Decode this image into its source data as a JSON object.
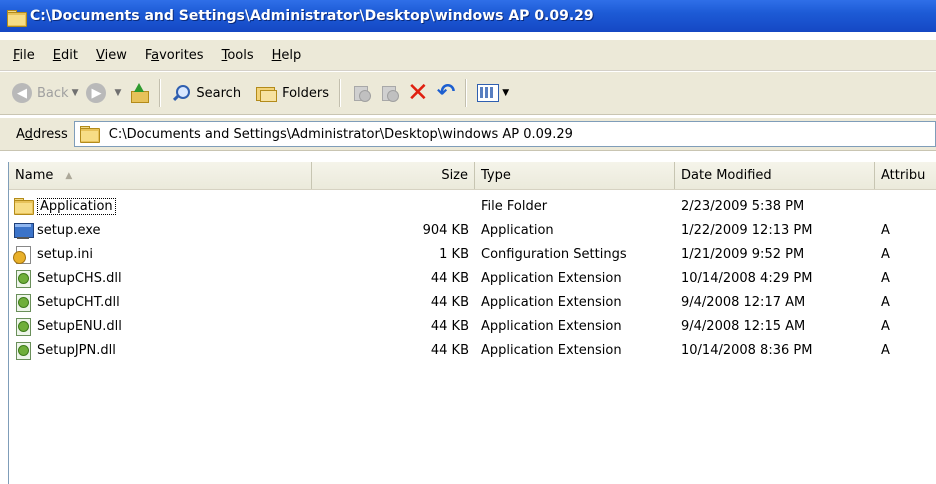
{
  "window": {
    "title": "C:\\Documents and Settings\\Administrator\\Desktop\\windows AP 0.09.29"
  },
  "menu": {
    "items": [
      {
        "pre": "",
        "key": "F",
        "post": "ile"
      },
      {
        "pre": "",
        "key": "E",
        "post": "dit"
      },
      {
        "pre": "",
        "key": "V",
        "post": "iew"
      },
      {
        "pre": "F",
        "key": "a",
        "post": "vorites"
      },
      {
        "pre": "",
        "key": "T",
        "post": "ools"
      },
      {
        "pre": "",
        "key": "H",
        "post": "elp"
      }
    ]
  },
  "toolbar": {
    "back_label": "Back",
    "search_label": "Search",
    "folders_label": "Folders"
  },
  "address": {
    "label_pre": "A",
    "label_key": "d",
    "label_post": "dress",
    "value": "C:\\Documents and Settings\\Administrator\\Desktop\\windows AP 0.09.29"
  },
  "list": {
    "columns": {
      "name": "Name",
      "size": "Size",
      "type": "Type",
      "date": "Date Modified",
      "attributes": "Attribu"
    },
    "rows": [
      {
        "icon": "folder-icon",
        "name": "Application",
        "size": "",
        "type": "File Folder",
        "date": "2/23/2009 5:38 PM",
        "attr": ""
      },
      {
        "icon": "application-exe-icon",
        "name": "setup.exe",
        "size": "904 KB",
        "type": "Application",
        "date": "1/22/2009 12:13 PM",
        "attr": "A"
      },
      {
        "icon": "config-settings-icon",
        "name": "setup.ini",
        "size": "1 KB",
        "type": "Configuration Settings",
        "date": "1/21/2009 9:52 PM",
        "attr": "A"
      },
      {
        "icon": "dll-icon",
        "name": "SetupCHS.dll",
        "size": "44 KB",
        "type": "Application Extension",
        "date": "10/14/2008 4:29 PM",
        "attr": "A"
      },
      {
        "icon": "dll-icon",
        "name": "SetupCHT.dll",
        "size": "44 KB",
        "type": "Application Extension",
        "date": "9/4/2008 12:17 AM",
        "attr": "A"
      },
      {
        "icon": "dll-icon",
        "name": "SetupENU.dll",
        "size": "44 KB",
        "type": "Application Extension",
        "date": "9/4/2008 12:15 AM",
        "attr": "A"
      },
      {
        "icon": "dll-icon",
        "name": "SetupJPN.dll",
        "size": "44 KB",
        "type": "Application Extension",
        "date": "10/14/2008 8:36 PM",
        "attr": "A"
      }
    ]
  }
}
